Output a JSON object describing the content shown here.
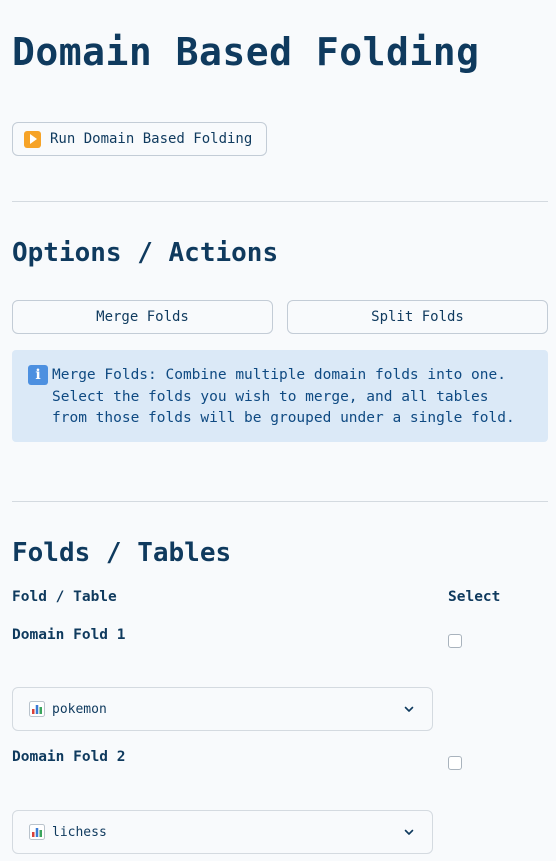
{
  "header": {
    "title": "Domain Based Folding"
  },
  "run": {
    "label": "Run Domain Based Folding"
  },
  "options": {
    "heading": "Options / Actions",
    "merge_label": "Merge Folds",
    "split_label": "Split Folds",
    "info_text": "Merge Folds: Combine multiple domain folds into one. Select the folds you wish to merge, and all tables from those folds will be grouped under a single fold."
  },
  "folds": {
    "heading": "Folds / Tables",
    "col_fold": "Fold / Table",
    "col_select": "Select",
    "items": [
      {
        "name": "Domain Fold 1",
        "table": "pokemon",
        "selected": false
      },
      {
        "name": "Domain Fold 2",
        "table": "lichess",
        "selected": false
      }
    ]
  },
  "colors": {
    "accent": "#0f3a5e",
    "info_bg": "#dbe9f7",
    "info_text": "#0f4a82"
  }
}
